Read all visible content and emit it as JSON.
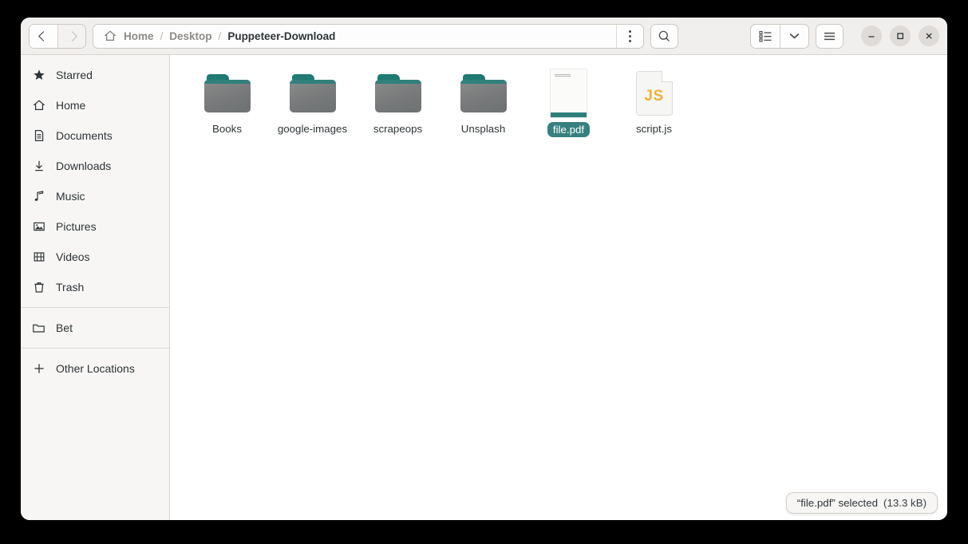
{
  "window": {
    "titlebar": {
      "nav": {
        "back_label": "Back",
        "forward_label": "Forward",
        "back_icon": "chevron-left-icon",
        "forward_icon": "chevron-right-icon"
      },
      "pathbar": {
        "home_icon": "home-icon",
        "crumbs": [
          {
            "label": "Home",
            "current": false
          },
          {
            "label": "Desktop",
            "current": false
          },
          {
            "label": "Puppeteer-Download",
            "current": true
          }
        ],
        "separator": "/",
        "menu_icon": "three-dots-vertical-icon"
      },
      "search_icon": "search-icon",
      "view_list_icon": "list-view-icon",
      "view_dropdown_icon": "chevron-down-icon",
      "hamburger_icon": "hamburger-menu-icon",
      "controls": {
        "minimize": "minimize-icon",
        "maximize": "maximize-icon",
        "close": "close-icon"
      }
    }
  },
  "sidebar": {
    "items": [
      {
        "label": "Starred",
        "icon": "star-icon"
      },
      {
        "label": "Home",
        "icon": "home-icon"
      },
      {
        "label": "Documents",
        "icon": "document-icon"
      },
      {
        "label": "Downloads",
        "icon": "download-arrow-icon"
      },
      {
        "label": "Music",
        "icon": "music-note-icon"
      },
      {
        "label": "Pictures",
        "icon": "image-icon"
      },
      {
        "label": "Videos",
        "icon": "film-strip-icon"
      },
      {
        "label": "Trash",
        "icon": "trash-icon"
      }
    ],
    "bookmarks": [
      {
        "label": "Bet",
        "icon": "folder-outline-icon"
      }
    ],
    "footer": [
      {
        "label": "Other Locations",
        "icon": "plus-icon"
      }
    ]
  },
  "files": [
    {
      "name": "Books",
      "type": "folder",
      "selected": false
    },
    {
      "name": "google-images",
      "type": "folder",
      "selected": false
    },
    {
      "name": "scrapeops",
      "type": "folder",
      "selected": false
    },
    {
      "name": "Unsplash",
      "type": "folder",
      "selected": false
    },
    {
      "name": "file.pdf",
      "type": "pdf",
      "selected": true
    },
    {
      "name": "script.js",
      "type": "js",
      "selected": false,
      "badge": "JS"
    }
  ],
  "status": {
    "text": "“file.pdf” selected",
    "size": "(13.3 kB)"
  },
  "colors": {
    "accent_teal": "#37807f",
    "folder_tab": "#1f7a72",
    "js_orange": "#f0b03c",
    "headerbar": "#f0efee",
    "sidebar": "#f7f6f5"
  }
}
